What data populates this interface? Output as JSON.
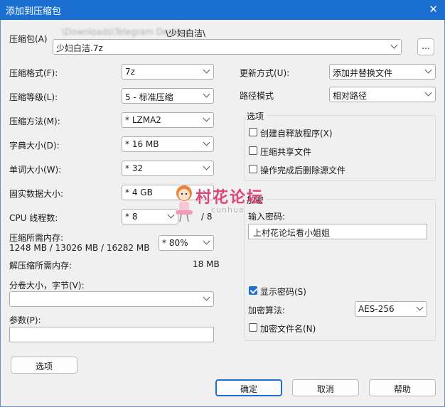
{
  "window": {
    "title": "添加到压缩包",
    "close_icon": "close-icon"
  },
  "archive": {
    "label": "压缩包(A)",
    "path_blurred": "\\Downloads\\Telegram Desktop",
    "path_suffix": "\\少妇白洁\\",
    "filename": "少妇白洁.7z",
    "browse_label": "..."
  },
  "left": {
    "format_label": "压缩格式(F):",
    "format_value": "7z",
    "level_label": "压缩等级(L):",
    "level_value": "5 - 标准压缩",
    "method_label": "压缩方法(M):",
    "method_value": "*  LZMA2",
    "dict_label": "字典大小(D):",
    "dict_value": "*  16 MB",
    "word_label": "单词大小(W):",
    "word_value": "*  32",
    "solid_label": "固实数据大小:",
    "solid_value": "*  4 GB",
    "cpu_label": "CPU 线程数:",
    "cpu_value": "*  8",
    "cpu_total": "/ 8",
    "mem_label": "压缩所需内存:",
    "mem_value": "1248 MB / 13026 MB / 16282 MB",
    "mem_percent": "* 80%",
    "decomp_label": "解压缩所需内存:",
    "decomp_value": "18 MB",
    "volume_label": "分卷大小，字节(V):",
    "volume_value": "",
    "params_label": "参数(P):",
    "params_value": "",
    "options_button": "选项"
  },
  "right": {
    "update_label": "更新方式(U):",
    "update_value": "添加并替换文件",
    "pathmode_label": "路径模式",
    "pathmode_value": "相对路径",
    "options_group": "选项",
    "opt_sfx": "创建自释放程序(X)",
    "opt_shared": "压缩共享文件",
    "opt_delete": "操作完成后删除源文件",
    "encrypt_group": "加密",
    "password_label": "输入密码:",
    "password_value": "上村花论坛看小姐姐",
    "show_password": "显示密码(S)",
    "enc_method_label": "加密算法:",
    "enc_method_value": "AES-256",
    "encrypt_names": "加密文件名(N)"
  },
  "buttons": {
    "ok": "确定",
    "cancel": "取消",
    "help": "帮助"
  },
  "watermark": {
    "title": "村花论坛",
    "subtitle": "cunhua"
  },
  "colors": {
    "titlebar": "#1a6fd1",
    "accent": "#1a6fd1",
    "watermark": "#e0447a"
  }
}
